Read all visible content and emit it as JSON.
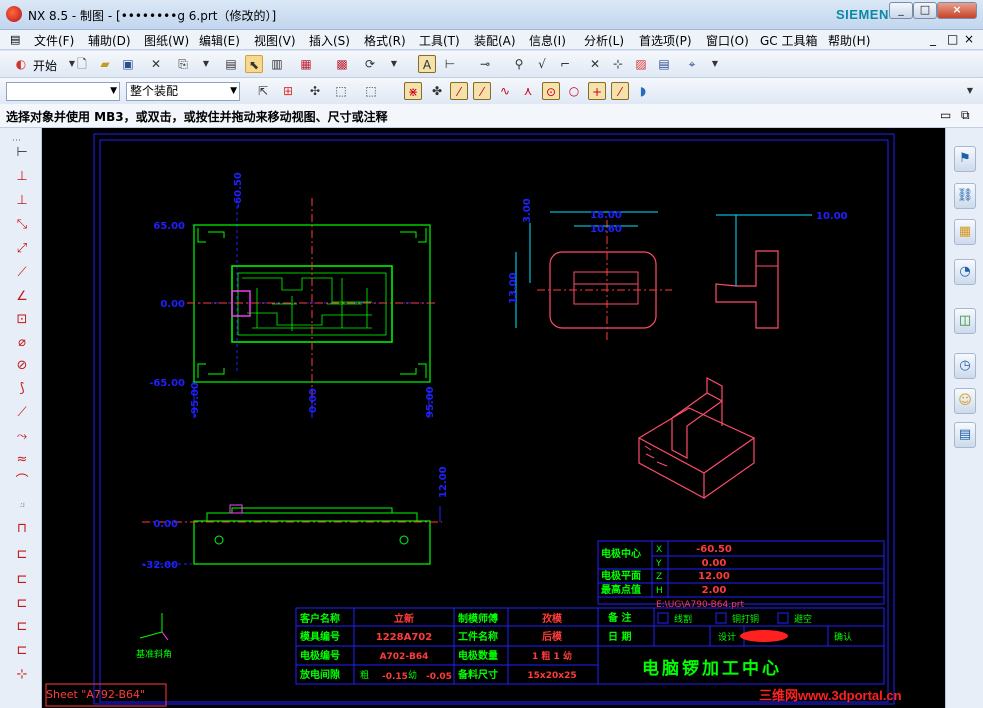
{
  "window": {
    "title": "NX 8.5 - 制图 - [••••••••g 6.prt（修改的）]",
    "brand": "SIEMENS",
    "controls": [
      "_",
      "□",
      "×"
    ]
  },
  "menu": {
    "items": [
      "文件(F)",
      "辅助(D)",
      "图纸(W)",
      "编辑(E)",
      "视图(V)",
      "插入(S)",
      "格式(R)",
      "工具(T)",
      "装配(A)",
      "信息(I)",
      "分析(L)",
      "首选项(P)",
      "窗口(O)",
      "GC 工具箱",
      "帮助(H)"
    ],
    "right_controls": [
      "_",
      "□",
      "×"
    ]
  },
  "toolbar1": {
    "start_label": "开始"
  },
  "toolbar2": {
    "filter_value": "",
    "scope_value": "整个装配"
  },
  "status": {
    "message": "选择对象并使用 MB3，或双击，或按住并拖动来移动视图、尺寸或注释"
  },
  "drawing": {
    "top_view": {
      "dims_y": [
        "65.00",
        "0.00",
        "-65.00"
      ],
      "dims_x": [
        "-95.00",
        "0.00",
        "95.00"
      ],
      "dim_top": "-60.50"
    },
    "front_view": {
      "dims_y": [
        "0.00",
        "-32.00"
      ],
      "dim_side": "12.00"
    },
    "electrode_views": {
      "dim_a": "3.00",
      "dim_b": "18.00",
      "dim_c": "10.60",
      "dim_d": "13.00",
      "dim_e": "10.00"
    },
    "datum_label": "基准斜角",
    "coord_table": {
      "label_center": "电极中心",
      "label_plane": "电极平面",
      "label_top": "最高点值",
      "axes": [
        "X",
        "Y",
        "Z",
        "H"
      ],
      "values": [
        "-60.50",
        "0.00",
        "12.00",
        "2.00"
      ],
      "path": "E:\\UG\\A790-B64.prt"
    },
    "title_block": {
      "row1": [
        "客户名称",
        "立新",
        "制模师傅",
        "孜模"
      ],
      "row2": [
        "模具编号",
        "1228A702",
        "工件名称",
        "后模"
      ],
      "row3": [
        "电极编号",
        "A702-B64",
        "电极数量",
        "1 粗  1 幼"
      ],
      "row4_label": "放电间隙",
      "row4_coarse": "粗",
      "row4_coarse_val": "-0.15",
      "row4_fine": "幼",
      "row4_fine_val": "-0.05",
      "row4b": [
        "备料尺寸",
        "15x20x25"
      ],
      "remarks_label": "备  注",
      "checks": [
        "线割",
        "铜打铜",
        "避空"
      ],
      "date_label": "日  期",
      "design_label": "设计",
      "confirm_label": "确认",
      "company": "电脑锣加工中心"
    },
    "sheet_label": "Sheet \"A792-B64\"",
    "watermark": "三维网www.3dportal.cn"
  },
  "colors": {
    "green": "#00ff00",
    "blue": "#2020ff",
    "red": "#ff3b3b",
    "pink": "#ff4b6b",
    "cyan": "#00e5ff",
    "white": "#ffffff",
    "magenta": "#ff40ff"
  }
}
